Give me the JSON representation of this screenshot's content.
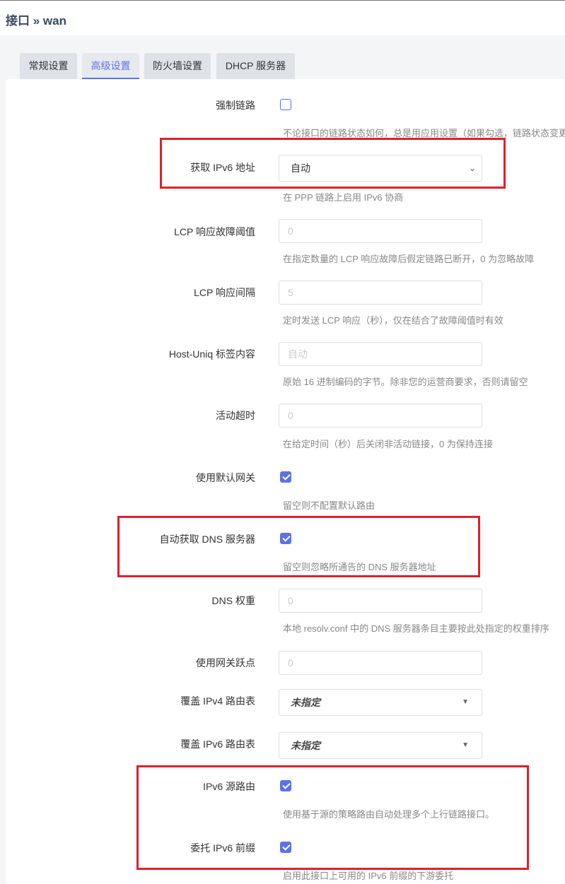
{
  "header": {
    "title": "接口 » wan"
  },
  "tabs": [
    {
      "label": "常规设置"
    },
    {
      "label": "高级设置"
    },
    {
      "label": "防火墙设置"
    },
    {
      "label": "DHCP 服务器"
    }
  ],
  "form": {
    "force_link": {
      "label": "强制链路",
      "checked": false,
      "desc": "不论接口的链路状态如何，总是用应用设置（如果勾选，链路状态变更"
    },
    "ipv6": {
      "label": "获取 IPv6 地址",
      "value": "自动",
      "desc": "在 PPP 链路上启用 IPv6 协商"
    },
    "lcp_failure": {
      "label": "LCP 响应故障阈值",
      "placeholder": "0",
      "desc": "在指定数量的 LCP 响应故障后假定链路已断开，0 为忽略故障"
    },
    "lcp_interval": {
      "label": "LCP 响应间隔",
      "placeholder": "5",
      "desc": "定时发送 LCP 响应（秒），仅在结合了故障阈值时有效"
    },
    "host_uniq": {
      "label": "Host-Uniq 标签内容",
      "placeholder": "自动",
      "desc": "原始 16 进制编码的字节。除非您的运营商要求，否则请留空"
    },
    "idle_timeout": {
      "label": "活动超时",
      "placeholder": "0",
      "desc": "在给定时间（秒）后关闭非活动链接，0 为保持连接"
    },
    "default_gw": {
      "label": "使用默认网关",
      "checked": true,
      "desc": "留空则不配置默认路由"
    },
    "peer_dns": {
      "label": "自动获取 DNS 服务器",
      "checked": true,
      "desc": "留空则忽略所通告的 DNS 服务器地址"
    },
    "dns_weight": {
      "label": "DNS 权重",
      "placeholder": "0",
      "desc": "本地 resolv.conf 中的 DNS 服务器条目主要按此处指定的权重排序"
    },
    "gw_metric": {
      "label": "使用网关跃点",
      "placeholder": "0"
    },
    "ip4table": {
      "label": "覆盖 IPv4 路由表",
      "value": "未指定"
    },
    "ip6table": {
      "label": "覆盖 IPv6 路由表",
      "value": "未指定"
    },
    "sourcefilter": {
      "label": "IPv6 源路由",
      "checked": true,
      "desc": "使用基于源的策略路由自动处理多个上行链路接口。"
    },
    "delegate": {
      "label": "委托 IPv6 前缀",
      "checked": true,
      "desc": "启用此接口上可用的 IPv6 前缀的下游委托"
    }
  },
  "colors": {
    "accent": "#5e72e4",
    "highlight": "#e0202a"
  }
}
